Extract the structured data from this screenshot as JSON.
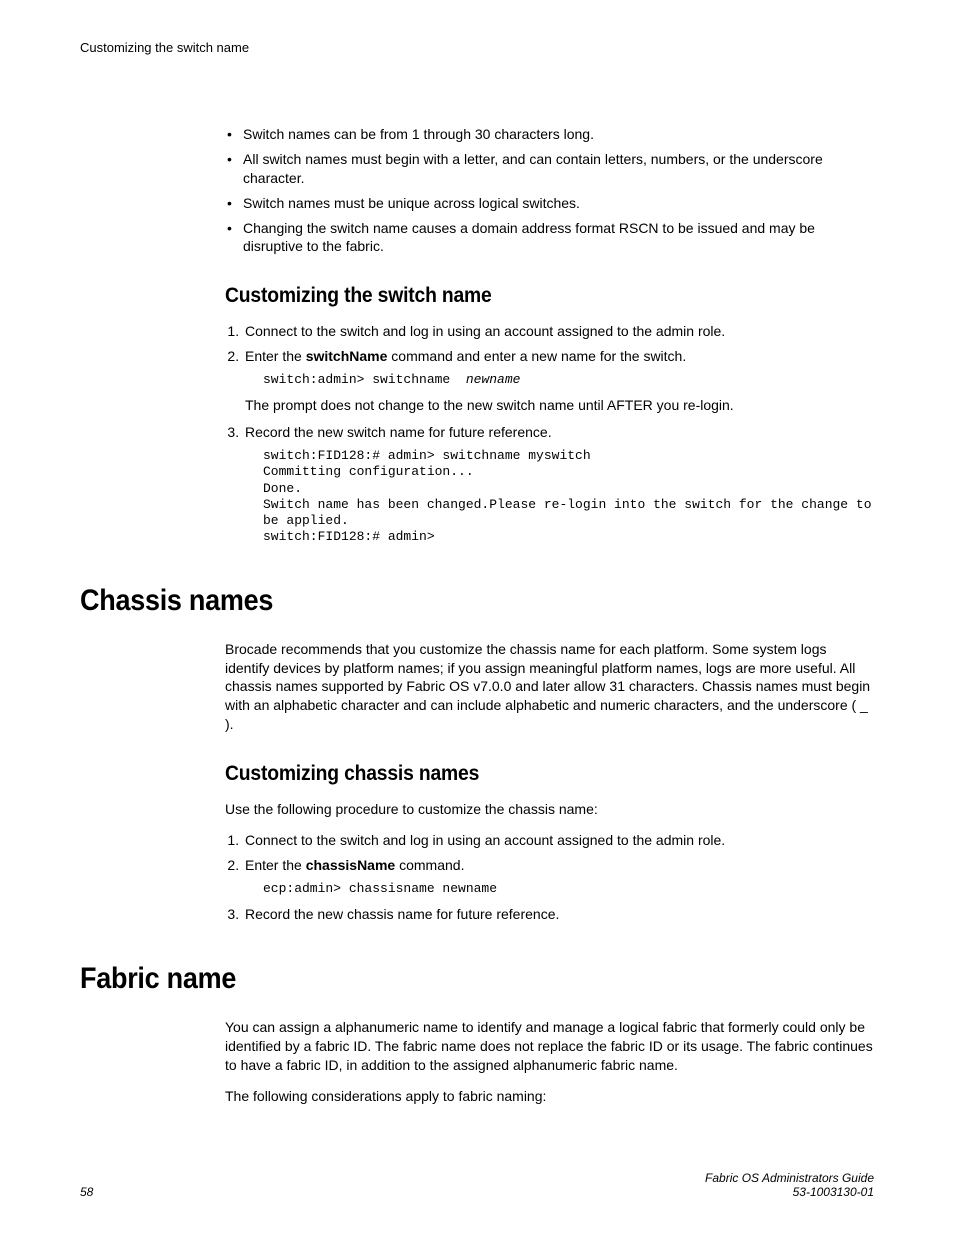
{
  "header": {
    "running": "Customizing the switch name"
  },
  "bullets": [
    "Switch names can be from 1 through 30 characters long.",
    "All switch names must begin with a letter, and can contain letters, numbers, or the underscore character.",
    "Switch names must be unique across logical switches.",
    "Changing the switch name causes a domain address format RSCN to be issued and may be disruptive to the fabric."
  ],
  "sec1": {
    "title": "Customizing the switch name",
    "step1": "Connect to the switch and log in using an account assigned to the admin role.",
    "step2_pre": "Enter the ",
    "step2_cmd": "switchName",
    "step2_post": " command and enter a new name for the switch.",
    "code1_a": "switch:admin> switchname  ",
    "code1_b": "newname",
    "note": "The prompt does not change to the new switch name until AFTER you re-login.",
    "step3": "Record the new switch name for future reference.",
    "code2": "switch:FID128:# admin> switchname myswitch\nCommitting configuration...\nDone.\nSwitch name has been changed.Please re-login into the switch for the change to be applied.\nswitch:FID128:# admin>"
  },
  "sec2": {
    "title": "Chassis names",
    "intro": "Brocade recommends that you customize the chassis name for each platform. Some system logs identify devices by platform names; if you assign meaningful platform names, logs are more useful. All chassis names supported by Fabric OS v7.0.0 and later allow 31 characters. Chassis names must begin with an alphabetic character and can include alphabetic and numeric characters, and the underscore ( _ ).",
    "sub_title": "Customizing chassis names",
    "sub_intro": "Use the following procedure to customize the chassis name:",
    "step1": "Connect to the switch and log in using an account assigned to the admin role.",
    "step2_pre": "Enter the ",
    "step2_cmd": "chassisName",
    "step2_post": " command.",
    "code": "ecp:admin> chassisname newname",
    "step3": "Record the new chassis name for future reference."
  },
  "sec3": {
    "title": "Fabric name",
    "p1": "You can assign a alphanumeric name to identify and manage a logical fabric that formerly could only be identified by a fabric ID. The fabric name does not replace the fabric ID or its usage. The fabric continues to have a fabric ID, in addition to the assigned alphanumeric fabric name.",
    "p2": "The following considerations apply to fabric naming:"
  },
  "footer": {
    "page": "58",
    "title": "Fabric OS Administrators Guide",
    "docnum": "53-1003130-01"
  }
}
